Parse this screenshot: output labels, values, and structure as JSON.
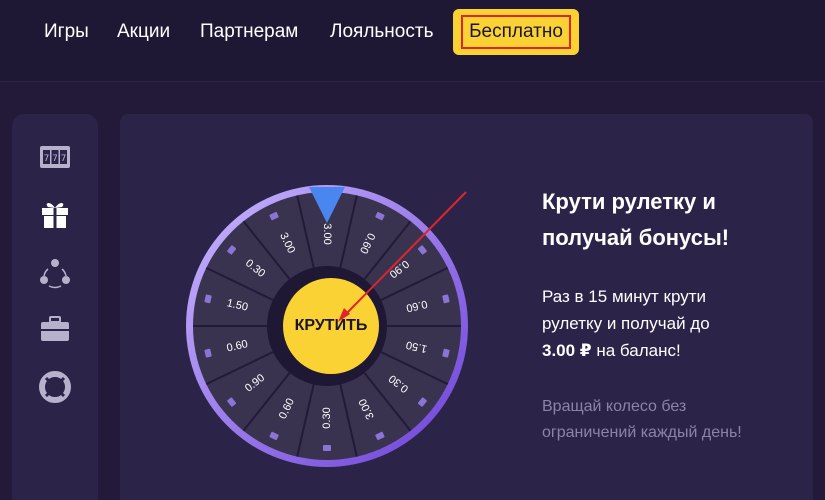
{
  "nav": {
    "games": "Игры",
    "promos": "Акции",
    "partners": "Партнерам",
    "loyalty": "Лояльность",
    "free": "Бесплатно"
  },
  "sidebar": {
    "items": [
      {
        "icon": "slot-machine-icon"
      },
      {
        "icon": "gift-icon"
      },
      {
        "icon": "referral-network-icon"
      },
      {
        "icon": "briefcase-icon"
      },
      {
        "icon": "lifebuoy-icon"
      }
    ]
  },
  "wheel": {
    "segments": [
      "3.00",
      "0.60",
      "0.90",
      "0.60",
      "1.50",
      "0.30",
      "3.00",
      "0.30",
      "0.60",
      "0.90",
      "0.60",
      "1.50",
      "0.30",
      "3.00"
    ],
    "spin_label": "КРУТИТЬ"
  },
  "promo": {
    "title": "Крути рулетку и получай бонусы!",
    "text_before": "Раз в 15 минут крути рулетку и получай до ",
    "text_amount": "3.00 ₽",
    "text_after": " на баланс!",
    "note": "Вращай колесо без ограничений каждый день!"
  },
  "colors": {
    "accent": "#fbd233",
    "background": "#221a38",
    "panel": "#2c2448",
    "wheel_rim": "#7d5fd6",
    "pointer": "#4a86f0"
  }
}
